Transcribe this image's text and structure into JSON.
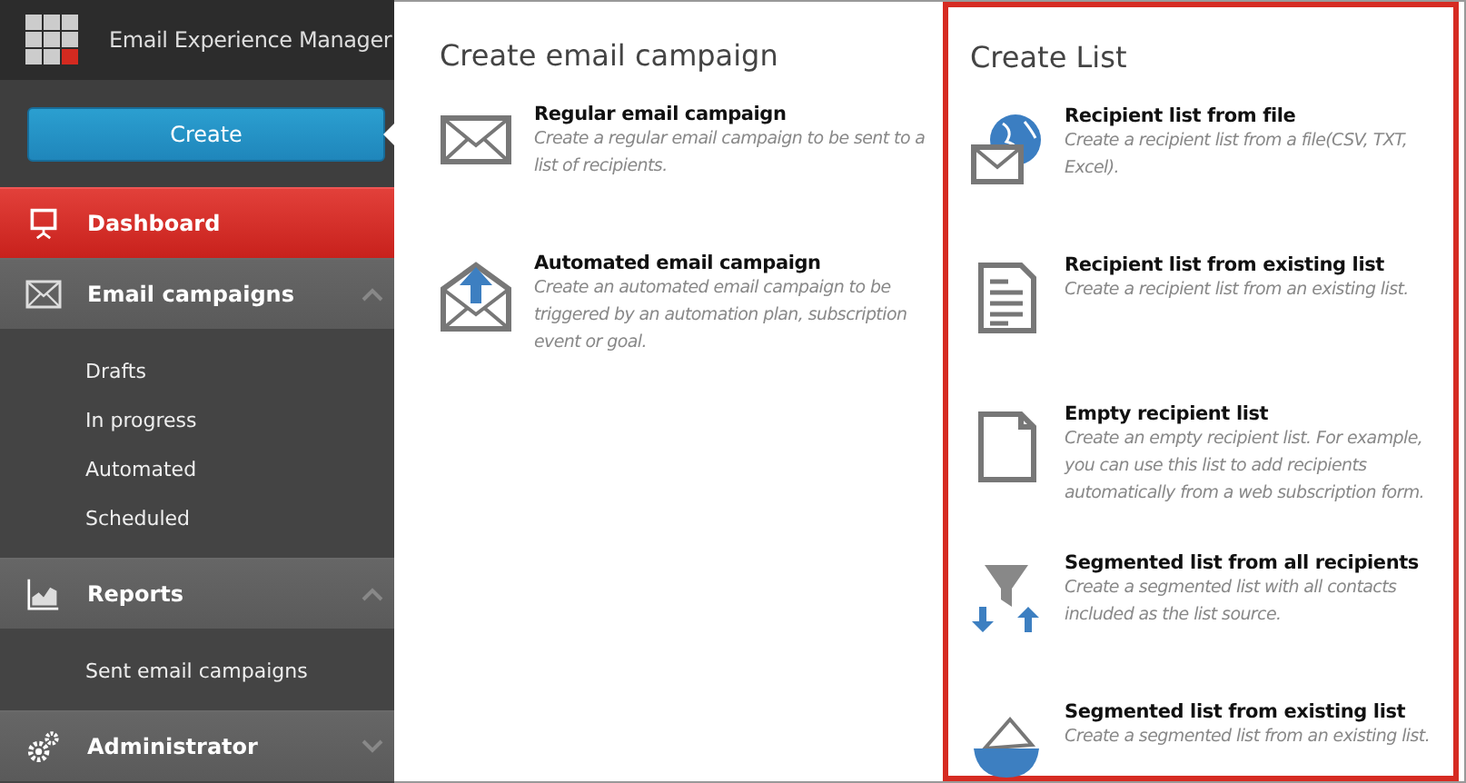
{
  "app_title": "Email Experience Manager",
  "create_button": "Create",
  "sidebar": {
    "sections": [
      {
        "label": "Dashboard",
        "selected": true
      },
      {
        "label": "Email campaigns",
        "selected": false,
        "expanded": true,
        "children": [
          {
            "label": "Drafts"
          },
          {
            "label": "In progress"
          },
          {
            "label": "Automated"
          },
          {
            "label": "Scheduled"
          }
        ]
      },
      {
        "label": "Reports",
        "selected": false,
        "expanded": true,
        "children": [
          {
            "label": "Sent email campaigns"
          }
        ]
      },
      {
        "label": "Administrator",
        "selected": false,
        "expanded": false
      }
    ]
  },
  "columns": [
    {
      "title": "Create email campaign",
      "highlighted": false,
      "options": [
        {
          "title": "Regular email campaign",
          "description": "Create a regular email campaign to be sent to a list of recipients."
        },
        {
          "title": "Automated email campaign",
          "description": "Create an automated email campaign to be triggered by an automation plan, subscription event or goal."
        }
      ]
    },
    {
      "title": "Create List",
      "highlighted": true,
      "options": [
        {
          "title": "Recipient list from file",
          "description": "Create a recipient list from a file(CSV, TXT, Excel)."
        },
        {
          "title": "Recipient list from existing list",
          "description": "Create a recipient list from an existing list."
        },
        {
          "title": "Empty recipient list",
          "description": "Create an empty recipient list. For example, you can use this list to add recipients automatically from a web subscription form."
        },
        {
          "title": "Segmented list from all recipients",
          "description": "Create a segmented list with all contacts included as the list source."
        },
        {
          "title": "Segmented list from existing list",
          "description": "Create a segmented list from an existing list."
        }
      ]
    }
  ]
}
